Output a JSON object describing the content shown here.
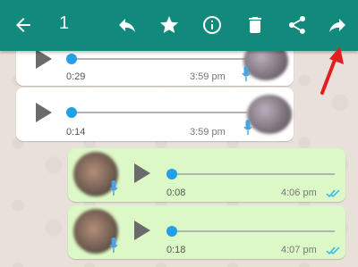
{
  "toolbar": {
    "selected_count": "1",
    "icons": [
      "back-arrow-icon",
      "reply-icon",
      "star-icon",
      "info-icon",
      "delete-icon",
      "share-icon",
      "forward-icon"
    ]
  },
  "messages": [
    {
      "direction": "incoming",
      "duration": "0:29",
      "time": "3:59 pm"
    },
    {
      "direction": "incoming",
      "duration": "0:14",
      "time": "3:59 pm"
    },
    {
      "direction": "outgoing",
      "duration": "0:08",
      "time": "4:06 pm"
    },
    {
      "direction": "outgoing",
      "duration": "0:18",
      "time": "4:07 pm"
    }
  ],
  "colors": {
    "toolbar": "#128a7b",
    "outgoing_bubble": "#dcf8c6",
    "incoming_bubble": "#ffffff",
    "progress_knob": "#22a0e5",
    "annotation_arrow": "#e02020",
    "read_ticks": "#34b7f1"
  }
}
